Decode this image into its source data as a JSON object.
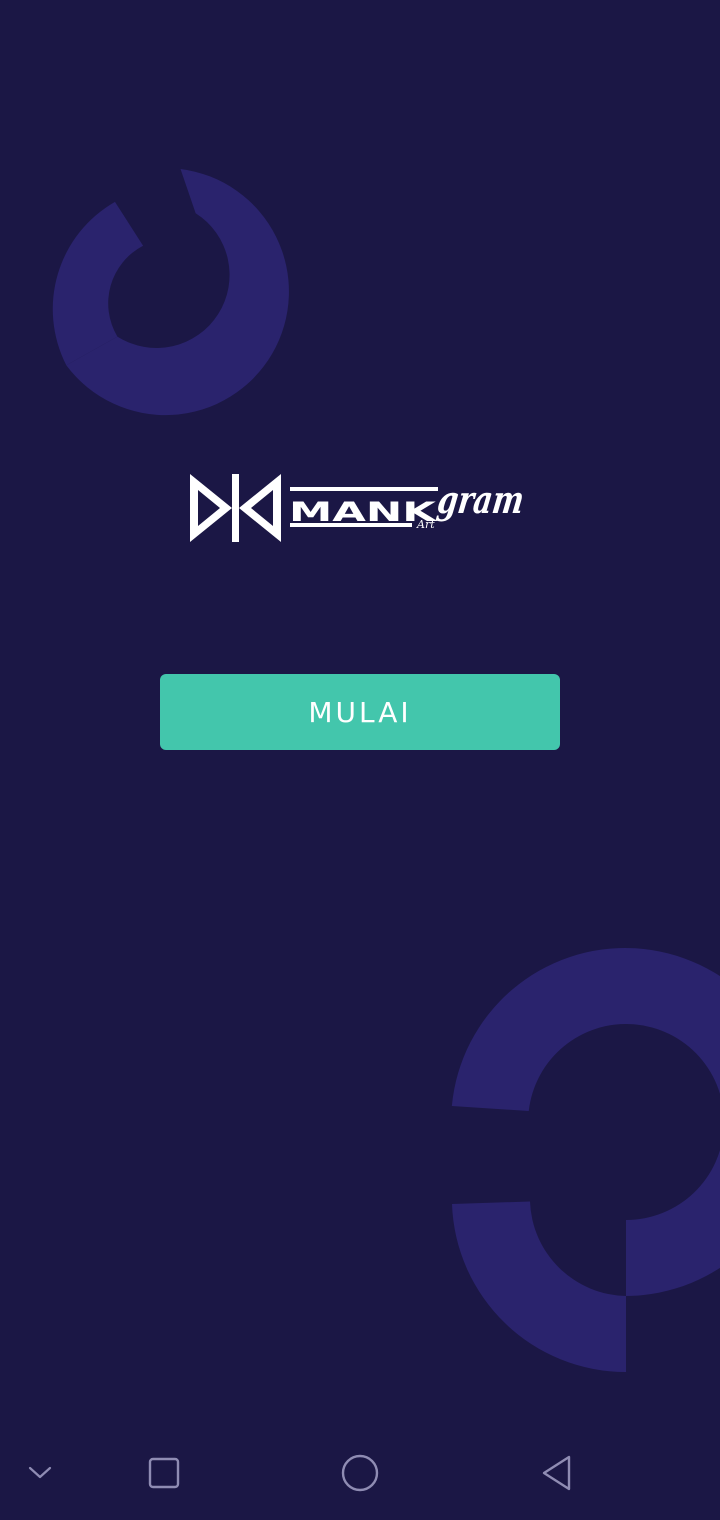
{
  "logo": {
    "brand": "MANK",
    "subtext": "Art",
    "script": "gram"
  },
  "start_button": {
    "label": "MULAI"
  },
  "colors": {
    "background": "#1b1745",
    "decor_ring": "#2a236d",
    "button": "#43c6ac",
    "logo": "#ffffff"
  },
  "nav_bar": {
    "buttons": [
      "chevron-down-icon",
      "square-recents-icon",
      "circle-home-icon",
      "triangle-back-icon"
    ]
  }
}
